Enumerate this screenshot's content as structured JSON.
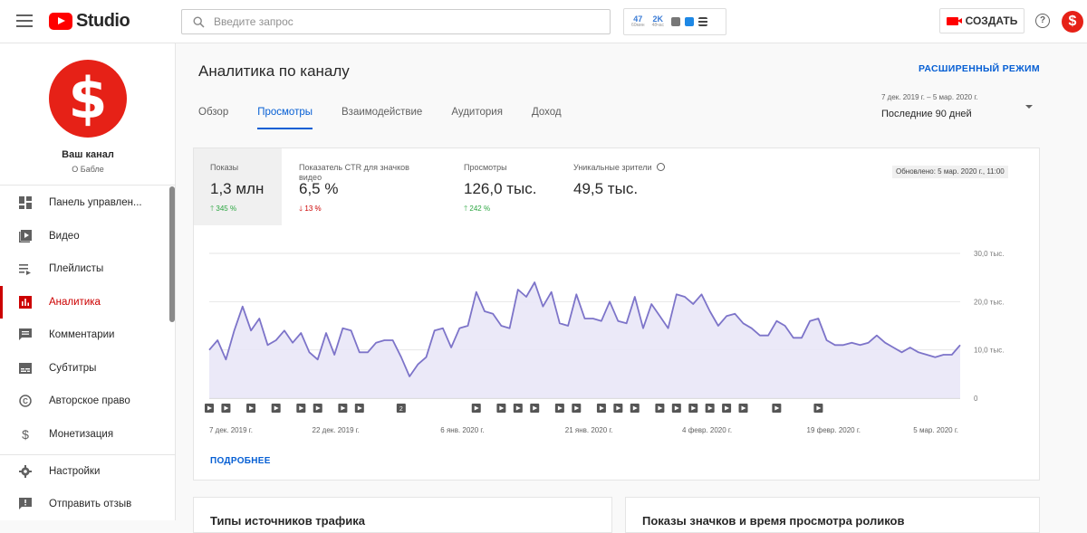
{
  "app": {
    "logo_text": "Studio",
    "search_placeholder": "Введите запрос",
    "create_label": "СОЗДАТЬ"
  },
  "extension": {
    "stat1_value": "47",
    "stat1_label": "60мин",
    "stat2_value": "2K",
    "stat2_label": "48час"
  },
  "channel": {
    "name": "Ваш канал",
    "subtitle": "О Бабле",
    "avatar_glyph": "$"
  },
  "sidebar": {
    "items": [
      {
        "label": "Панель управлен...",
        "icon": "dashboard-icon",
        "active": false
      },
      {
        "label": "Видео",
        "icon": "video-icon",
        "active": false
      },
      {
        "label": "Плейлисты",
        "icon": "playlist-icon",
        "active": false
      },
      {
        "label": "Аналитика",
        "icon": "analytics-icon",
        "active": true
      },
      {
        "label": "Комментарии",
        "icon": "comment-icon",
        "active": false
      },
      {
        "label": "Субтитры",
        "icon": "subtitles-icon",
        "active": false
      },
      {
        "label": "Авторское право",
        "icon": "copyright-icon",
        "active": false
      },
      {
        "label": "Монетизация",
        "icon": "dollar-icon",
        "active": false
      },
      {
        "label": "Настройки",
        "icon": "gear-icon",
        "active": false
      },
      {
        "label": "Отправить отзыв",
        "icon": "feedback-icon",
        "active": false
      }
    ]
  },
  "main": {
    "title": "Аналитика по каналу",
    "advanced_link": "РАСШИРЕННЫЙ РЕЖИМ",
    "tabs": [
      {
        "label": "Обзор",
        "active": false
      },
      {
        "label": "Просмотры",
        "active": true
      },
      {
        "label": "Взаимодействие",
        "active": false
      },
      {
        "label": "Аудитория",
        "active": false
      },
      {
        "label": "Доход",
        "active": false
      }
    ],
    "date_range": "7 дек. 2019 г. – 5 мар. 2020 г.",
    "period_label": "Последние 90 дней",
    "updated": "Обновлено: 5 мар. 2020 г., 11:00",
    "more_link": "ПОДРОБНЕЕ",
    "bottom_cards": [
      "Типы источников трафика",
      "Показы значков и время просмотра роликов"
    ]
  },
  "metrics": [
    {
      "label": "Показы",
      "value": "1,3 млн",
      "delta": "345 %",
      "direction": "up"
    },
    {
      "label": "Показатель CTR для значков видео",
      "value": "6,5 %",
      "delta": "13 %",
      "direction": "down"
    },
    {
      "label": "Просмотры",
      "value": "126,0 тыс.",
      "delta": "242 %",
      "direction": "up"
    },
    {
      "label": "Уникальные зрители",
      "value": "49,5 тыс.",
      "delta": "",
      "direction": "none",
      "has_clock": true
    }
  ],
  "colors": {
    "brand_red": "#ff0000",
    "accent_blue": "#065fd4",
    "active_red": "#cc0000",
    "series_line": "#7d74c9",
    "series_fill": "#e9e7f7",
    "up_green": "#2ba640",
    "down_red": "#cc0000"
  },
  "chart_data": {
    "type": "area",
    "title": "",
    "xlabel": "",
    "ylabel": "",
    "ylim": [
      0,
      30000
    ],
    "yticks": [
      0,
      10000,
      20000,
      30000
    ],
    "ytick_labels": [
      "0",
      "10,0 тыс.",
      "20,0 тыс.",
      "30,0 тыс."
    ],
    "grid": true,
    "x_start": "2019-12-07",
    "x_end": "2020-03-05",
    "xtick_labels": [
      {
        "date": "2019-12-07",
        "label": "7 дек. 2019 г."
      },
      {
        "date": "2019-12-22",
        "label": "22 дек. 2019 г."
      },
      {
        "date": "2020-01-06",
        "label": "6 янв. 2020 г."
      },
      {
        "date": "2020-01-21",
        "label": "21 янв. 2020 г."
      },
      {
        "date": "2020-02-04",
        "label": "4 февр. 2020 г."
      },
      {
        "date": "2020-02-19",
        "label": "19 февр. 2020 г."
      },
      {
        "date": "2020-03-05",
        "label": "5 мар. 2020 г."
      }
    ],
    "series": [
      {
        "values": [
          10000,
          12000,
          8000,
          14000,
          19000,
          14000,
          16500,
          11000,
          12000,
          14000,
          11500,
          13500,
          9500,
          8000,
          13500,
          9000,
          14500,
          14000,
          9500,
          9500,
          11500,
          12000,
          12000,
          8500,
          4500,
          7000,
          8500,
          14000,
          14500,
          10500,
          14500,
          15000,
          22000,
          18000,
          17500,
          15000,
          14500,
          22500,
          21000,
          24000,
          19000,
          22000,
          15500,
          15000,
          21500,
          16500,
          16500,
          16000,
          20000,
          16000,
          15500,
          21000,
          14500,
          19500,
          17000,
          14500,
          21500,
          21000,
          19500,
          21500,
          18000,
          15000,
          17000,
          17500,
          15500,
          14500,
          13000,
          13000,
          16000,
          15000,
          12500,
          12500,
          16000,
          16500,
          12000,
          11000,
          11000,
          11500,
          11000,
          11500,
          13000,
          11500,
          10500,
          9500,
          10500,
          9500,
          9000,
          8500,
          9000,
          9000,
          11000
        ]
      }
    ],
    "video_markers": [
      {
        "index": 0,
        "label": ""
      },
      {
        "index": 2,
        "label": ""
      },
      {
        "index": 5,
        "label": ""
      },
      {
        "index": 8,
        "label": ""
      },
      {
        "index": 11,
        "label": ""
      },
      {
        "index": 13,
        "label": ""
      },
      {
        "index": 16,
        "label": ""
      },
      {
        "index": 18,
        "label": ""
      },
      {
        "index": 23,
        "label": "2"
      },
      {
        "index": 32,
        "label": ""
      },
      {
        "index": 35,
        "label": ""
      },
      {
        "index": 37,
        "label": ""
      },
      {
        "index": 39,
        "label": ""
      },
      {
        "index": 42,
        "label": ""
      },
      {
        "index": 44,
        "label": ""
      },
      {
        "index": 47,
        "label": ""
      },
      {
        "index": 49,
        "label": ""
      },
      {
        "index": 51,
        "label": ""
      },
      {
        "index": 54,
        "label": ""
      },
      {
        "index": 56,
        "label": ""
      },
      {
        "index": 58,
        "label": ""
      },
      {
        "index": 60,
        "label": ""
      },
      {
        "index": 62,
        "label": ""
      },
      {
        "index": 64,
        "label": ""
      },
      {
        "index": 68,
        "label": ""
      },
      {
        "index": 73,
        "label": ""
      }
    ]
  }
}
